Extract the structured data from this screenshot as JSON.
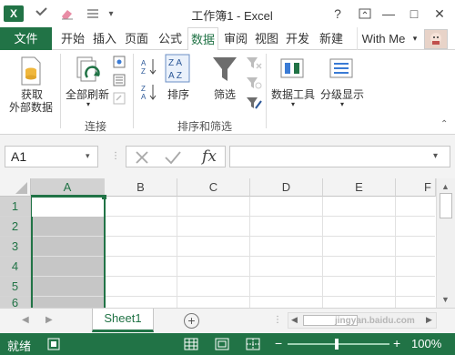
{
  "titlebar": {
    "title": "工作簿1 - Excel",
    "help": "?",
    "minimize": "—",
    "maximize": "□",
    "close": "✕"
  },
  "tabs": {
    "file": "文件",
    "home": "开始",
    "insert": "插入",
    "page": "页面",
    "formulas": "公式",
    "data": "数据",
    "review": "审阅",
    "view": "视图",
    "developer": "开发",
    "new": "新建",
    "user": "With Me"
  },
  "ribbon": {
    "get_external_1": "获取",
    "get_external_2": "外部数据",
    "refresh_all": "全部刷新",
    "sort": "排序",
    "filter": "筛选",
    "data_tools": "数据工具",
    "outline": "分级显示",
    "group_connections": "连接",
    "group_sort_filter": "排序和筛选"
  },
  "formula_bar": {
    "name_box": "A1",
    "fx": "fx",
    "formula": ""
  },
  "grid": {
    "columns": [
      "A",
      "B",
      "C",
      "D",
      "E",
      "F"
    ],
    "rows": [
      "1",
      "2",
      "3",
      "4",
      "5",
      "6"
    ]
  },
  "sheets": {
    "active": "Sheet1"
  },
  "status": {
    "ready": "就绪",
    "zoom": "100%",
    "watermark": "jingyan.baidu.com"
  },
  "colors": {
    "accent": "#217346",
    "selection": "#c6c6c6"
  }
}
